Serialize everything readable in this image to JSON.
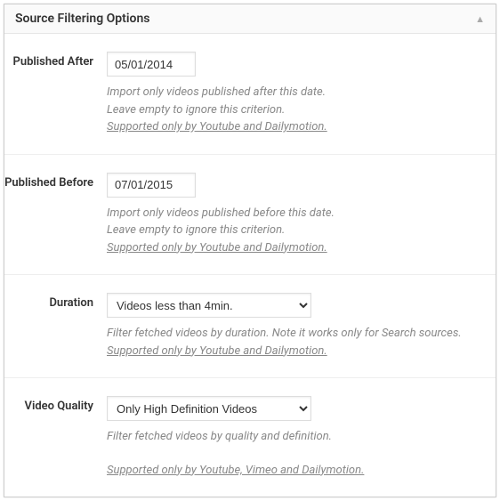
{
  "panel": {
    "title": "Source Filtering Options"
  },
  "fields": {
    "publishedAfter": {
      "label": "Published After",
      "value": "05/01/2014",
      "help1": "Import only videos published after this date.",
      "help2": "Leave empty to ignore this criterion.",
      "support": "Supported only by Youtube and Dailymotion."
    },
    "publishedBefore": {
      "label": "Published Before",
      "value": "07/01/2015",
      "help1": "Import only videos published before this date.",
      "help2": "Leave empty to ignore this criterion.",
      "support": "Supported only by Youtube and Dailymotion."
    },
    "duration": {
      "label": "Duration",
      "selected": "Videos less than 4min.",
      "help1": "Filter fetched videos by duration. Note it works only for Search sources.",
      "support": "Supported only by Youtube and Dailymotion."
    },
    "videoQuality": {
      "label": "Video Quality",
      "selected": "Only High Definition Videos",
      "help1": "Filter fetched videos by quality and definition.",
      "support": "Supported only by Youtube, Vimeo and Dailymotion."
    }
  }
}
